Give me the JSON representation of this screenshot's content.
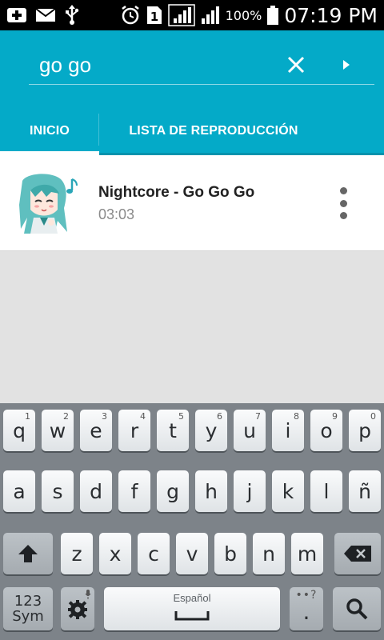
{
  "status_bar": {
    "battery_percent": "100%",
    "time": "07:19 PM",
    "sim_slot": "1",
    "icons": [
      "notification-add-icon",
      "email-icon",
      "usb-icon",
      "alarm-icon",
      "sim-icon",
      "signal-icon",
      "signal-icon-2",
      "battery-icon"
    ]
  },
  "search": {
    "query": "go go",
    "clear_icon": "close-icon",
    "submit_icon": "play-arrow-icon"
  },
  "tabs": [
    {
      "label": "INICIO",
      "selected": true
    },
    {
      "label": "LISTA DE REPRODUCCIÓN",
      "selected": false
    }
  ],
  "results": [
    {
      "title": "Nightcore - Go Go Go",
      "duration": "03:03",
      "thumbnail": "anime-girl-thumbnail",
      "menu_icon": "more-vert-icon"
    }
  ],
  "keyboard": {
    "row1": [
      {
        "k": "q",
        "h": "1"
      },
      {
        "k": "w",
        "h": "2"
      },
      {
        "k": "e",
        "h": "3"
      },
      {
        "k": "r",
        "h": "4"
      },
      {
        "k": "t",
        "h": "5"
      },
      {
        "k": "y",
        "h": "6"
      },
      {
        "k": "u",
        "h": "7"
      },
      {
        "k": "i",
        "h": "8"
      },
      {
        "k": "o",
        "h": "9"
      },
      {
        "k": "p",
        "h": "0"
      }
    ],
    "row2": [
      "a",
      "s",
      "d",
      "f",
      "g",
      "h",
      "j",
      "k",
      "l",
      "ñ"
    ],
    "row3": [
      "z",
      "x",
      "c",
      "v",
      "b",
      "n",
      "m"
    ],
    "sym_label_top": "123",
    "sym_label_bottom": "Sym",
    "space_label": "Español",
    "period": ".",
    "period_hints": "••?",
    "colors": {
      "accent": "#04aac8",
      "keyboard_bg": "#7d8389",
      "key": "#f2f4f6"
    }
  }
}
